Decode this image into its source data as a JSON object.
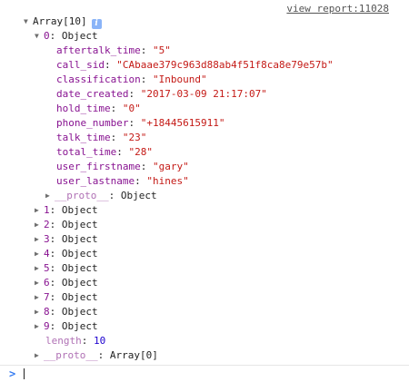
{
  "source_link": "view report:11028",
  "array_header": "Array[10]",
  "info_badge": "i",
  "expanded_item": {
    "index": "0",
    "label": "Object",
    "properties": [
      {
        "key": "aftertalk_time",
        "value": "\"5\""
      },
      {
        "key": "call_sid",
        "value": "\"CAbaae379c963d88ab4f51f8ca8e79e57b\""
      },
      {
        "key": "classification",
        "value": "\"Inbound\""
      },
      {
        "key": "date_created",
        "value": "\"2017-03-09 21:17:07\""
      },
      {
        "key": "hold_time",
        "value": "\"0\""
      },
      {
        "key": "phone_number",
        "value": "\"+18445615911\""
      },
      {
        "key": "talk_time",
        "value": "\"23\""
      },
      {
        "key": "total_time",
        "value": "\"28\""
      },
      {
        "key": "user_firstname",
        "value": "\"gary\""
      },
      {
        "key": "user_lastname",
        "value": "\"hines\""
      }
    ],
    "proto": {
      "key": "__proto__",
      "value": "Object"
    }
  },
  "collapsed_items": [
    {
      "index": "1",
      "label": "Object"
    },
    {
      "index": "2",
      "label": "Object"
    },
    {
      "index": "3",
      "label": "Object"
    },
    {
      "index": "4",
      "label": "Object"
    },
    {
      "index": "5",
      "label": "Object"
    },
    {
      "index": "6",
      "label": "Object"
    },
    {
      "index": "7",
      "label": "Object"
    },
    {
      "index": "8",
      "label": "Object"
    },
    {
      "index": "9",
      "label": "Object"
    }
  ],
  "length": {
    "key": "length",
    "value": "10"
  },
  "array_proto": {
    "key": "__proto__",
    "value": "Array[0]"
  },
  "prompt_symbol": ">",
  "icons": {
    "expanded": "triangle-down-icon",
    "collapsed": "triangle-right-icon",
    "prompt": "chevron-right-icon"
  },
  "colors": {
    "own_key": "#881391",
    "dim_key": "#b071b5",
    "string_value": "#c41a16",
    "number_value": "#1c00cf",
    "prompt": "#367cf1"
  }
}
